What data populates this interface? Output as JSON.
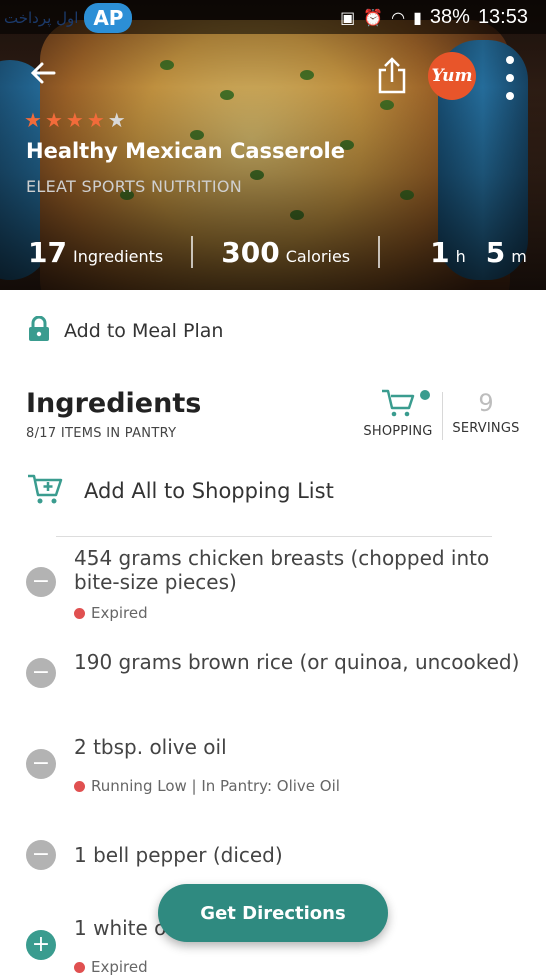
{
  "status_bar": {
    "logo_text": "اول پرداخت",
    "logo_mark": "AP",
    "battery": "38%",
    "time": "13:53"
  },
  "recipe": {
    "title": "Healthy Mexican Casserole",
    "source": "ELEAT SPORTS NUTRITION",
    "rating": 4,
    "rating_max": 5,
    "yum_label": "Yum",
    "stats": {
      "ingredients_num": "17",
      "ingredients_label": "Ingredients",
      "calories_num": "300",
      "calories_label": "Calories",
      "time_h_num": "1",
      "time_h_unit": "h",
      "time_m_num": "5",
      "time_m_unit": "m"
    }
  },
  "meal_plan": {
    "label": "Add to Meal Plan"
  },
  "ingredients": {
    "title": "Ingredients",
    "subtitle": "8/17 ITEMS IN PANTRY",
    "shopping_label": "SHOPPING",
    "servings_num": "9",
    "servings_label": "SERVINGS",
    "add_all_label": "Add All to Shopping List",
    "items": [
      {
        "text": "454 grams chicken breasts (chopped into bite-size pieces)",
        "status": "Expired"
      },
      {
        "text": "190 grams brown rice (or quinoa, uncooked)",
        "status": ""
      },
      {
        "text": "2 tbsp. olive oil",
        "status": "Running Low | In Pantry: Olive Oil"
      },
      {
        "text": "1 bell pepper (diced)",
        "status": ""
      },
      {
        "text": "1 white o",
        "status": "Expired"
      }
    ]
  },
  "fab": {
    "label": "Get Directions"
  },
  "colors": {
    "accent": "#2f8a80",
    "star": "#f26b3a",
    "yum": "#e8552a",
    "alert": "#e05050"
  }
}
